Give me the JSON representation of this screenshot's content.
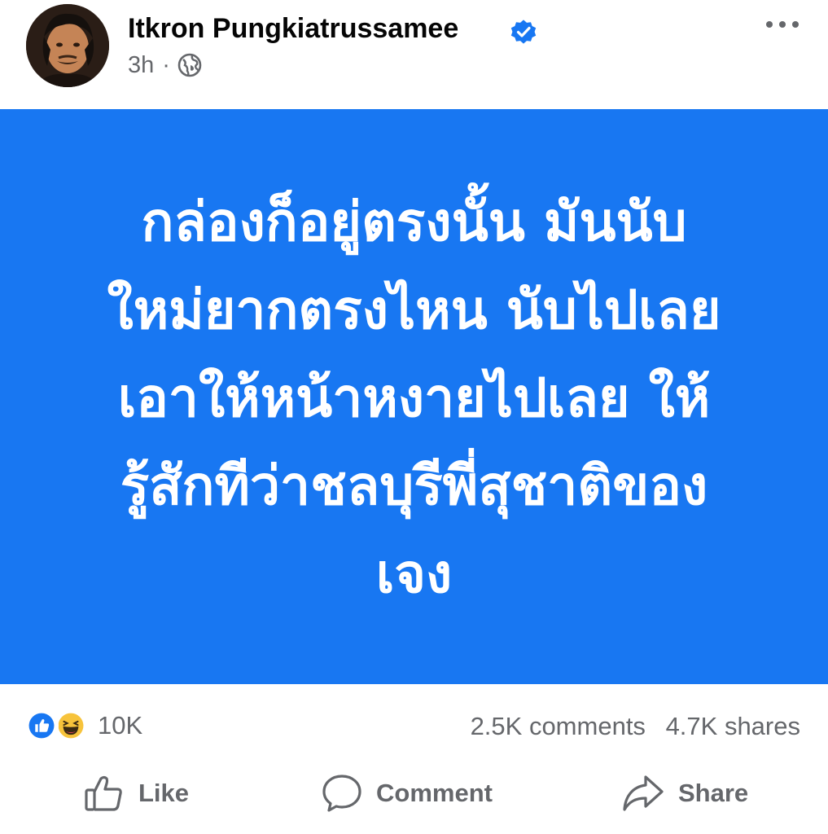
{
  "post": {
    "author": {
      "name": "Itkron Pungkiatrussamee",
      "verified": true,
      "avatar_icon": "profile-photo"
    },
    "meta": {
      "time": "3h",
      "separator": "·",
      "audience_icon": "globe-icon"
    },
    "more_icon": "more-horizontal-icon",
    "content": {
      "background_color": "#1877f2",
      "text_color": "#ffffff",
      "lines": [
        "กล่องก็อยู่ตรงนั้น มันนับ",
        "ใหม่ยากตรงไหน นับไปเลย",
        "เอาให้หน้าหงายไปเลย ให้",
        "รู้สักทีว่าชลบุรีพี่สุชาติของ",
        "เจง"
      ]
    },
    "stats": {
      "reaction_icons": [
        "like-reaction-icon",
        "haha-reaction-icon"
      ],
      "reaction_count": "10K",
      "comments": "2.5K comments",
      "shares": "4.7K shares"
    },
    "actions": {
      "like_label": "Like",
      "comment_label": "Comment",
      "share_label": "Share"
    }
  },
  "colors": {
    "accent": "#1877f2",
    "verified_badge": "#1877f2",
    "secondary_text": "#65676b",
    "primary_text": "#050505"
  }
}
